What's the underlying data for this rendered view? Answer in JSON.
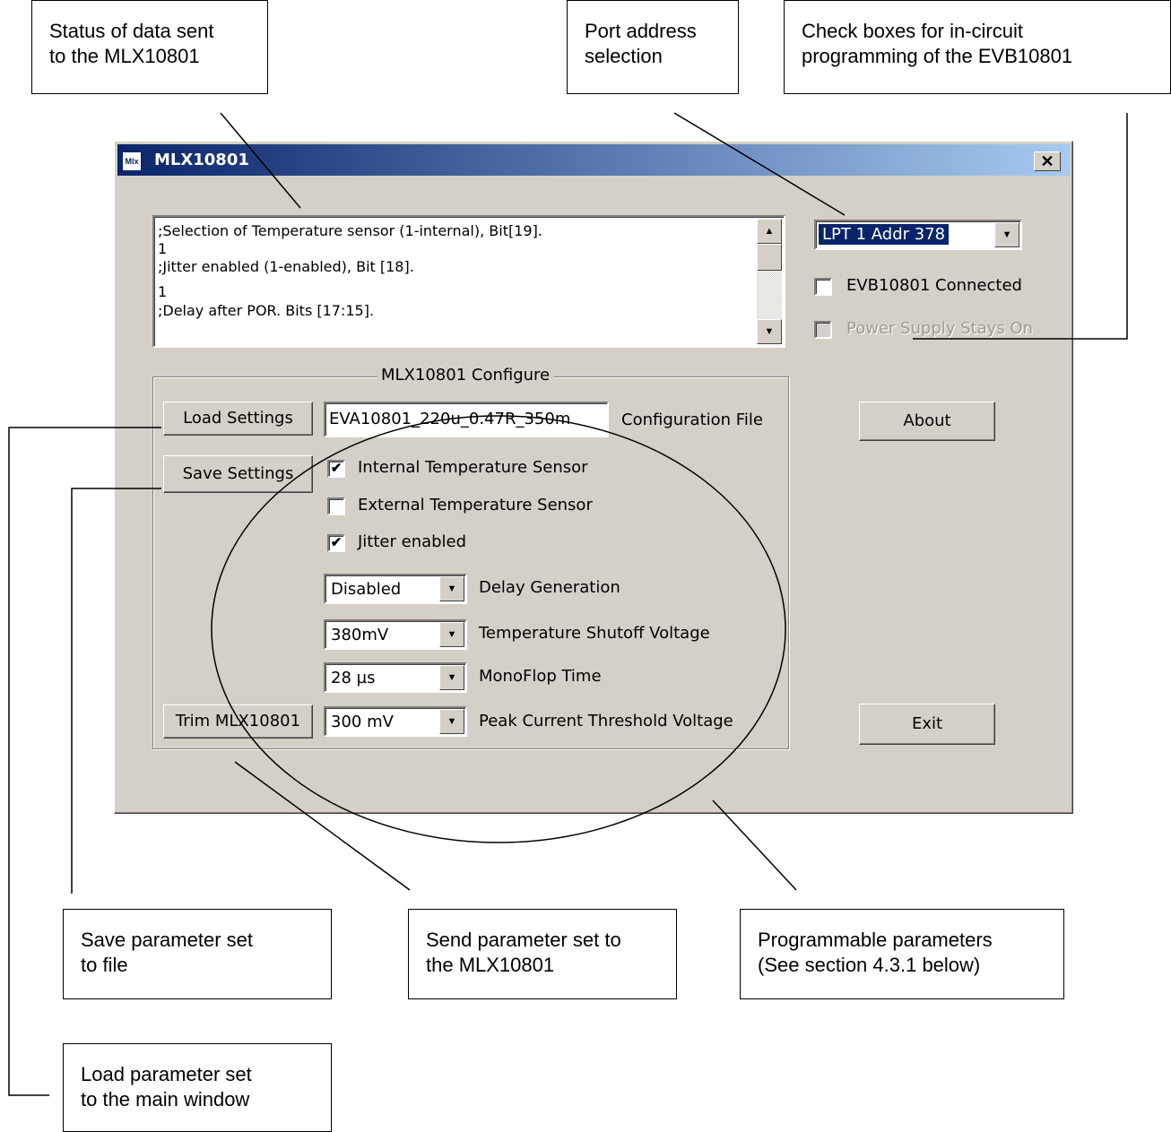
{
  "callouts": {
    "status": "Status of data sent\nto the MLX10801",
    "port": "Port address\nselection",
    "checkboxes": "Check boxes for in-circuit\nprogramming of the EVB10801",
    "save": "Save parameter set\nto file",
    "send": "Send parameter set to\nthe MLX10801",
    "params": "Programmable parameters\n(See section 4.3.1 below)",
    "load": "Load parameter set\nto the main window"
  },
  "window": {
    "icon_text": "Mlx",
    "title": "MLX10801",
    "close_glyph": "✕"
  },
  "status_box": {
    "lines": [
      ";Selection of Temperature sensor (1-internal), Bit[19].",
      "1",
      ";Jitter enabled (1-enabled), Bit [18].",
      "1",
      ";Delay after POR. Bits [17:15]."
    ]
  },
  "port": {
    "value": "LPT 1  Addr 378",
    "evb_connected_label": "EVB10801 Connected",
    "evb_connected_checked": false,
    "power_label": "Power Supply Stays On",
    "power_checked": false
  },
  "configure": {
    "group_title": "MLX10801 Configure",
    "load_button": "Load Settings",
    "save_button": "Save Settings",
    "trim_button": "Trim MLX10801",
    "config_file_value": "EVA10801_220u_0.47R_350m",
    "config_file_label": "Configuration File",
    "internal_sensor_label": "Internal Temperature Sensor",
    "internal_sensor_checked": true,
    "external_sensor_label": "External Temperature Sensor",
    "external_sensor_checked": false,
    "jitter_label": "Jitter enabled",
    "jitter_checked": true,
    "delay_value": "Disabled",
    "delay_label": "Delay Generation",
    "shutoff_value": "380mV",
    "shutoff_label": "Temperature Shutoff Voltage",
    "monoflop_value": "28 µs",
    "monoflop_label": "MonoFlop Time",
    "peak_value": "300 mV",
    "peak_label": "Peak Current Threshold Voltage"
  },
  "about_button": "About",
  "exit_button": "Exit",
  "check_glyph": "✔",
  "arrow_up": "▲",
  "arrow_down": "▼"
}
